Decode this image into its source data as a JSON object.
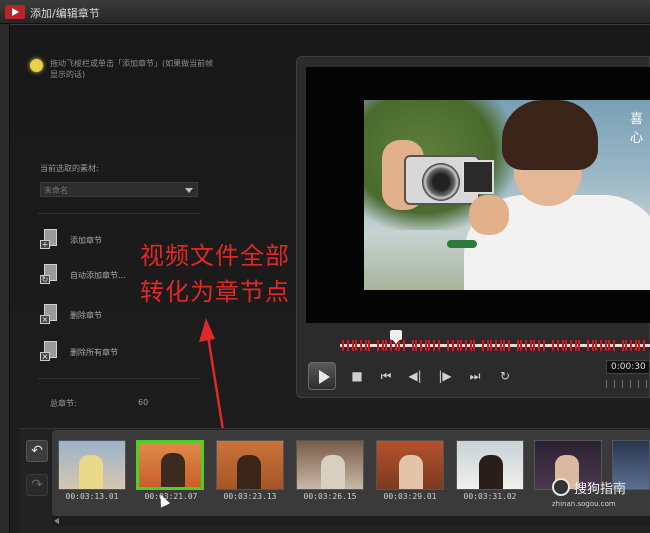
{
  "window": {
    "title": "添加/编辑章节"
  },
  "sidebar": {
    "tip": "拖动飞梭栏或单击「添加章节」(如果做当前帧显示的话)",
    "clip_label": "当前选取的素材:",
    "clip_value": "未命名",
    "actions": [
      {
        "label": "添加章节"
      },
      {
        "label": "自动添加章节..."
      },
      {
        "label": "删除章节"
      },
      {
        "label": "删除所有章节"
      }
    ],
    "total_label": "总章节:",
    "total_value": "60"
  },
  "preview": {
    "watermark": "喜心",
    "timecode": "0:00:30"
  },
  "controls": {
    "play": "play-icon",
    "stop": "■",
    "prev_chapter": "⏮",
    "step_back": "◀|",
    "step_forward": "|▶",
    "next_chapter": "⏭",
    "repeat": "↻"
  },
  "annotation": {
    "line1": "视频文件全部",
    "line2": "转化为章节点"
  },
  "undo": "↶",
  "redo": "↷",
  "chapters": [
    {
      "time": "00:03:13.01",
      "selected": false
    },
    {
      "time": "00:03:21.07",
      "selected": true
    },
    {
      "time": "00:03:23.13",
      "selected": false
    },
    {
      "time": "00:03:26.15",
      "selected": false
    },
    {
      "time": "00:03:29.01",
      "selected": false
    },
    {
      "time": "00:03:31.02",
      "selected": false
    },
    {
      "time": "",
      "selected": false
    },
    {
      "time": "",
      "selected": false
    }
  ],
  "watermark": {
    "name": "搜狗指南",
    "url": "zhinan.sogou.com"
  },
  "colors": {
    "accent_red": "#e02828",
    "selected_green": "#4bd11f",
    "marker_red": "#d4191e"
  }
}
